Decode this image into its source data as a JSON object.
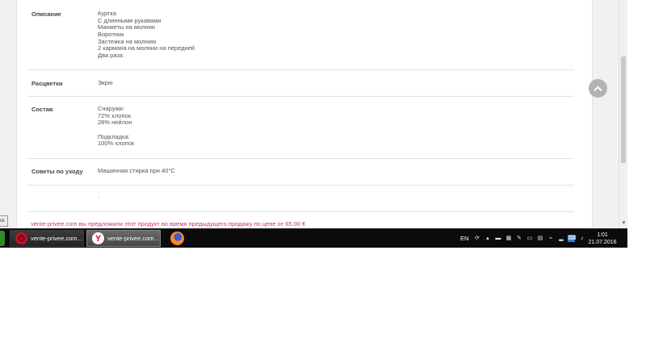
{
  "product_details": {
    "rows": [
      {
        "label": "Описание",
        "lines": [
          "Куртка",
          "С длинными рукавами",
          "Манжеты на молнии",
          "Воротник",
          "Застежка на молнию",
          "2 кармана на молнии на передней",
          "Два раза"
        ]
      },
      {
        "label": "Расцветки",
        "lines": [
          "Экрю"
        ]
      },
      {
        "label": "Состав",
        "lines": [
          "Снаружи:",
          "72% хлопок",
          "28% нейлон",
          "",
          "Подкладка:",
          "100% хлопок"
        ]
      },
      {
        "label": "Советы по уходу",
        "lines": [
          "Машинная стирка при 40°C"
        ]
      },
      {
        "label": "",
        "lines": [
          "-"
        ]
      }
    ]
  },
  "promo_text": "vente-privee.com вы предложили этот продукт во время предыдущего продажу по цене от 65.00 €",
  "side_tab": "ск",
  "taskbar": {
    "tasks": [
      {
        "label": "vente-privee.com...",
        "icon": "opera-icon"
      },
      {
        "label": "vente-privee.com...",
        "icon": "yandex-icon"
      },
      {
        "label": "",
        "icon": "firefox-icon"
      }
    ],
    "language": "EN",
    "clock_time": "1:01",
    "clock_date": "21.07.2016"
  },
  "colors": {
    "promo": "#d0307a",
    "taskbar": "#0b0b0c",
    "back_to_top": "#b3b3b3"
  }
}
